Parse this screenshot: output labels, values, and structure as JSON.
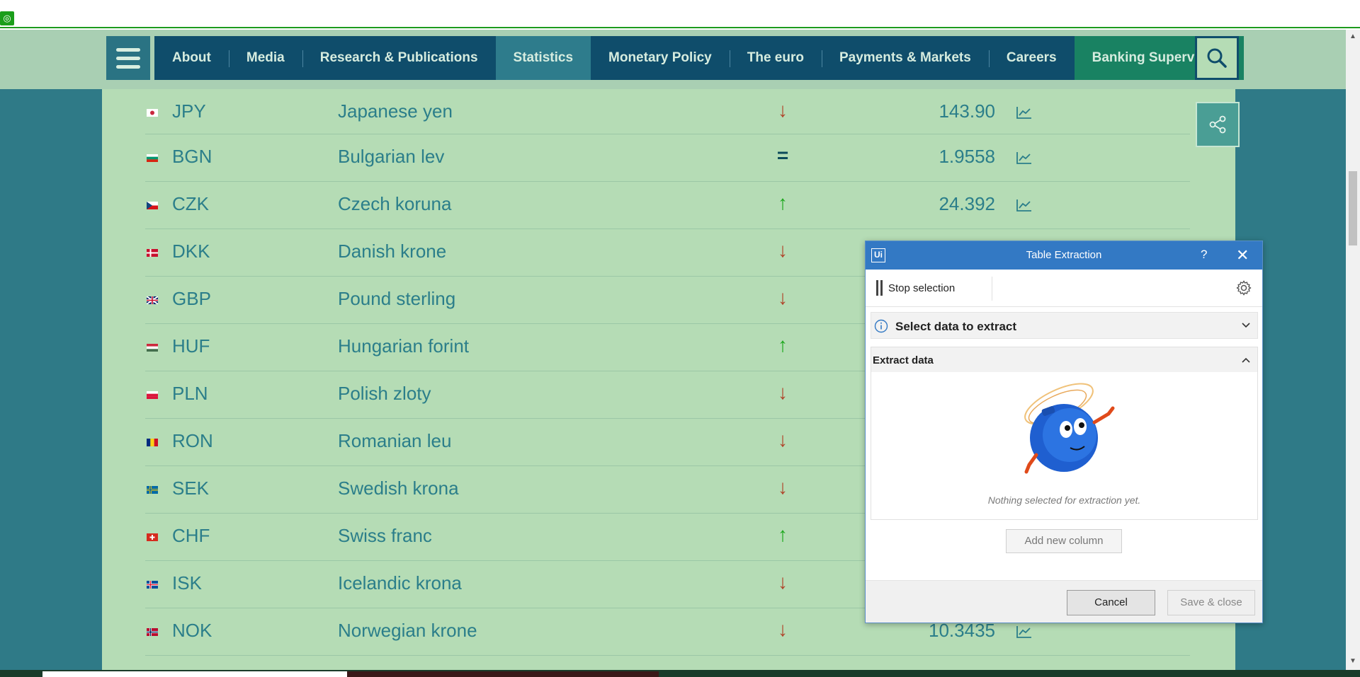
{
  "nav": {
    "items": [
      {
        "label": "About"
      },
      {
        "label": "Media"
      },
      {
        "label": "Research & Publications"
      },
      {
        "label": "Statistics"
      },
      {
        "label": "Monetary Policy"
      },
      {
        "label": "The euro"
      },
      {
        "label": "Payments & Markets"
      },
      {
        "label": "Careers"
      },
      {
        "label": "Banking Supervision"
      }
    ]
  },
  "rows": [
    {
      "code": "JPY",
      "name": "Japanese yen",
      "trend": "down",
      "trend_glyph": "↓",
      "rate": "143.90"
    },
    {
      "code": "BGN",
      "name": "Bulgarian lev",
      "trend": "eq",
      "trend_glyph": "=",
      "rate": "1.9558"
    },
    {
      "code": "CZK",
      "name": "Czech koruna",
      "trend": "up",
      "trend_glyph": "↑",
      "rate": "24.392"
    },
    {
      "code": "DKK",
      "name": "Danish krone",
      "trend": "down",
      "trend_glyph": "↓",
      "rate": ""
    },
    {
      "code": "GBP",
      "name": "Pound sterling",
      "trend": "down",
      "trend_glyph": "↓",
      "rate": ""
    },
    {
      "code": "HUF",
      "name": "Hungarian forint",
      "trend": "up",
      "trend_glyph": "↑",
      "rate": ""
    },
    {
      "code": "PLN",
      "name": "Polish zloty",
      "trend": "down",
      "trend_glyph": "↓",
      "rate": ""
    },
    {
      "code": "RON",
      "name": "Romanian leu",
      "trend": "down",
      "trend_glyph": "↓",
      "rate": ""
    },
    {
      "code": "SEK",
      "name": "Swedish krona",
      "trend": "down",
      "trend_glyph": "↓",
      "rate": ""
    },
    {
      "code": "CHF",
      "name": "Swiss franc",
      "trend": "up",
      "trend_glyph": "↑",
      "rate": ""
    },
    {
      "code": "ISK",
      "name": "Icelandic krona",
      "trend": "down",
      "trend_glyph": "↓",
      "rate": ""
    },
    {
      "code": "NOK",
      "name": "Norwegian krone",
      "trend": "down",
      "trend_glyph": "↓",
      "rate": "10.3435"
    }
  ],
  "dialog": {
    "logo": "Ui",
    "title": "Table Extraction",
    "help": "?",
    "close": "✕",
    "stop_selection": "Stop selection",
    "select_section": "Select data to extract",
    "extract_section": "Extract data",
    "empty_message": "Nothing selected for extraction yet.",
    "add_column": "Add new column",
    "cancel": "Cancel",
    "save_close": "Save & close"
  },
  "colors": {
    "nav_bg": "#0f4d6b",
    "nav_active": "#2e7c8c",
    "nav_green": "#198262",
    "content_bg": "#b5dcb5",
    "dialog_title": "#3379c4"
  }
}
